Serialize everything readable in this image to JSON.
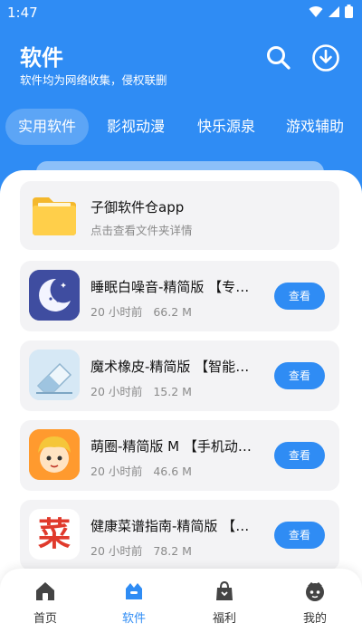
{
  "status": {
    "time": "1:47"
  },
  "header": {
    "title": "软件",
    "subtitle": "软件均为网络收集，侵权联删"
  },
  "tabs": [
    {
      "label": "实用软件",
      "active": true
    },
    {
      "label": "影视动漫",
      "active": false
    },
    {
      "label": "快乐源泉",
      "active": false
    },
    {
      "label": "游戏辅助",
      "active": false
    }
  ],
  "folder": {
    "title": "子御软件仓app",
    "subtitle": "点击查看文件夹详情"
  },
  "apps": [
    {
      "name": "睡眠白噪音-精简版          【专业助眠】",
      "time": "20 小时前",
      "size": "66.2 M",
      "button": "查看",
      "icon": "moon-sleep-icon"
    },
    {
      "name": "魔术橡皮-精简版          【智能修图】",
      "time": "20 小时前",
      "size": "15.2 M",
      "button": "查看",
      "icon": "eraser-icon"
    },
    {
      "name": "萌圈-精简版 M 【手机动漫追番】",
      "time": "20 小时前",
      "size": "46.6 M",
      "button": "查看",
      "icon": "anime-character-icon"
    },
    {
      "name": "健康菜谱指南-精简版          【拥有百万菜谱】",
      "time": "20 小时前",
      "size": "78.2 M",
      "button": "查看",
      "icon": "recipe-char-icon",
      "icon_text": "菜"
    }
  ],
  "bottom_nav": [
    {
      "label": "首页",
      "icon": "home-icon",
      "active": false
    },
    {
      "label": "软件",
      "icon": "software-icon",
      "active": true
    },
    {
      "label": "福利",
      "icon": "gift-bag-icon",
      "active": false
    },
    {
      "label": "我的",
      "icon": "profile-icon",
      "active": false
    }
  ],
  "colors": {
    "accent": "#2f8cf4",
    "card_bg": "#f3f3f5",
    "panel_bg": "#ffffff"
  }
}
